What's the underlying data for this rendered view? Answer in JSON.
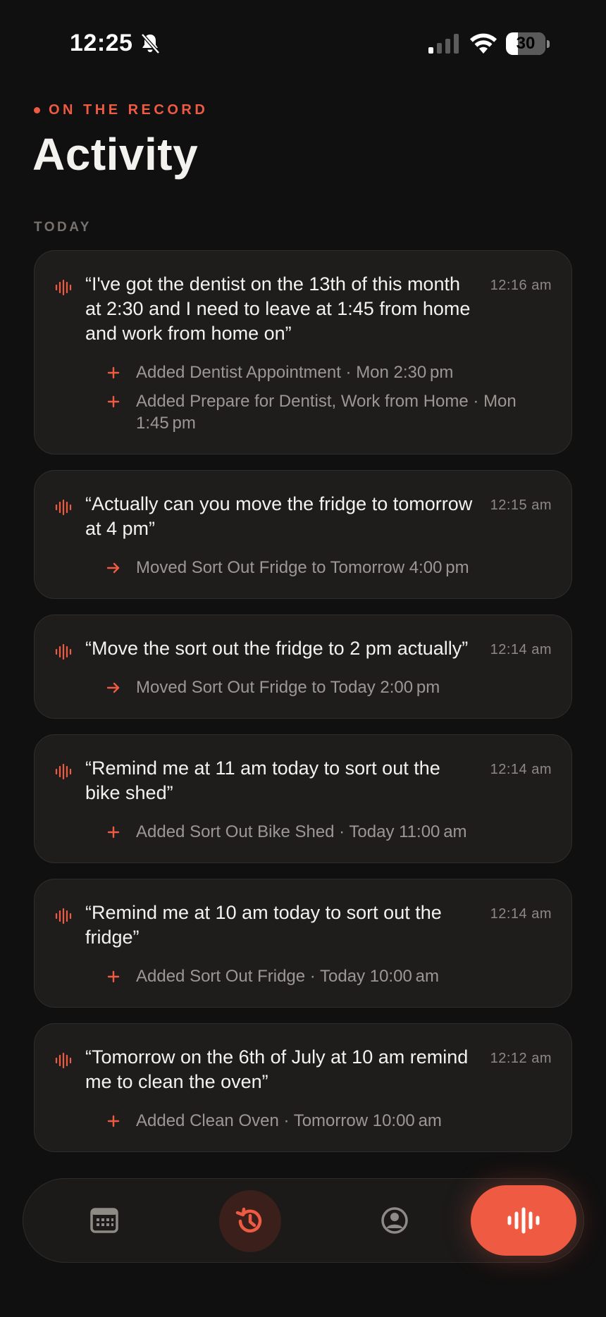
{
  "status_bar": {
    "time": "12:25",
    "battery_level": "30",
    "battery_fraction": 0.3,
    "icons": [
      "bell-slash-icon",
      "cellular-signal-icon",
      "wifi-icon",
      "battery-icon"
    ]
  },
  "header": {
    "eyebrow": "ON THE RECORD",
    "title": "Activity"
  },
  "section": {
    "label": "TODAY"
  },
  "entries": [
    {
      "quote": "“I've got the dentist on the 13th of this month at 2:30 and I need to leave at 1:45 from home and work from home on”",
      "time": "12:16 am",
      "actions": [
        {
          "type": "add",
          "icon": "plus-icon",
          "text": "Added Dentist Appointment · Mon 2:30 pm"
        },
        {
          "type": "add",
          "icon": "plus-icon",
          "text": "Added Prepare for Dentist, Work from Home · Mon 1:45 pm"
        }
      ]
    },
    {
      "quote": "“Actually can you move the fridge to tomorrow at 4 pm”",
      "time": "12:15 am",
      "actions": [
        {
          "type": "move",
          "icon": "arrow-right-icon",
          "text": "Moved Sort Out Fridge to Tomorrow 4:00 pm"
        }
      ]
    },
    {
      "quote": "“Move the sort out the fridge to 2 pm actually”",
      "time": "12:14 am",
      "actions": [
        {
          "type": "move",
          "icon": "arrow-right-icon",
          "text": "Moved Sort Out Fridge to Today 2:00 pm"
        }
      ]
    },
    {
      "quote": "“Remind me at 11 am today to sort out the bike shed”",
      "time": "12:14 am",
      "actions": [
        {
          "type": "add",
          "icon": "plus-icon",
          "text": "Added Sort Out Bike Shed · Today 11:00 am"
        }
      ]
    },
    {
      "quote": "“Remind me at 10 am today to sort out the fridge”",
      "time": "12:14 am",
      "actions": [
        {
          "type": "add",
          "icon": "plus-icon",
          "text": "Added Sort Out Fridge · Today 10:00 am"
        }
      ]
    },
    {
      "quote": "“Tomorrow on the 6th of July at 10 am remind me to clean the oven”",
      "time": "12:12 am",
      "actions": [
        {
          "type": "add",
          "icon": "plus-icon",
          "text": "Added Clean Oven · Tomorrow 10:00 am"
        }
      ]
    }
  ],
  "nav": {
    "items": [
      {
        "name": "calendar",
        "icon": "calendar-icon",
        "active": false
      },
      {
        "name": "history",
        "icon": "history-icon",
        "active": true
      },
      {
        "name": "profile",
        "icon": "user-circle-icon",
        "active": false
      }
    ],
    "record_icon": "waveform-icon"
  },
  "colors": {
    "accent": "#ef5a43",
    "background": "#111010",
    "card": "#1e1d1c",
    "muted_text": "#9c9793"
  }
}
